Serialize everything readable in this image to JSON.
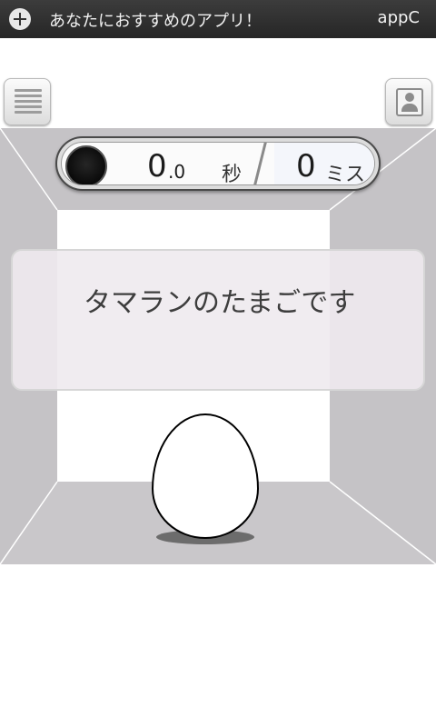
{
  "ad_bar": {
    "text": "あなたにおすすめのアプリ！",
    "brand": "appC",
    "plus_icon": "plus-circle-icon"
  },
  "toolbar": {
    "menu_icon": "menu-lines-icon",
    "photo_icon": "photo-portrait-icon"
  },
  "score": {
    "time_whole": "0",
    "time_fraction": ".0",
    "time_unit": "秒",
    "miss_count": "0",
    "miss_unit": "ミス"
  },
  "message": {
    "text": "タマランのたまごです"
  },
  "colors": {
    "ad_bar_bg": "#2f2f2f",
    "room_wall": "#c5c3c6",
    "room_back": "#ffffff",
    "message_panel": "#eeeaee",
    "text_dark": "#3d3d3d"
  }
}
